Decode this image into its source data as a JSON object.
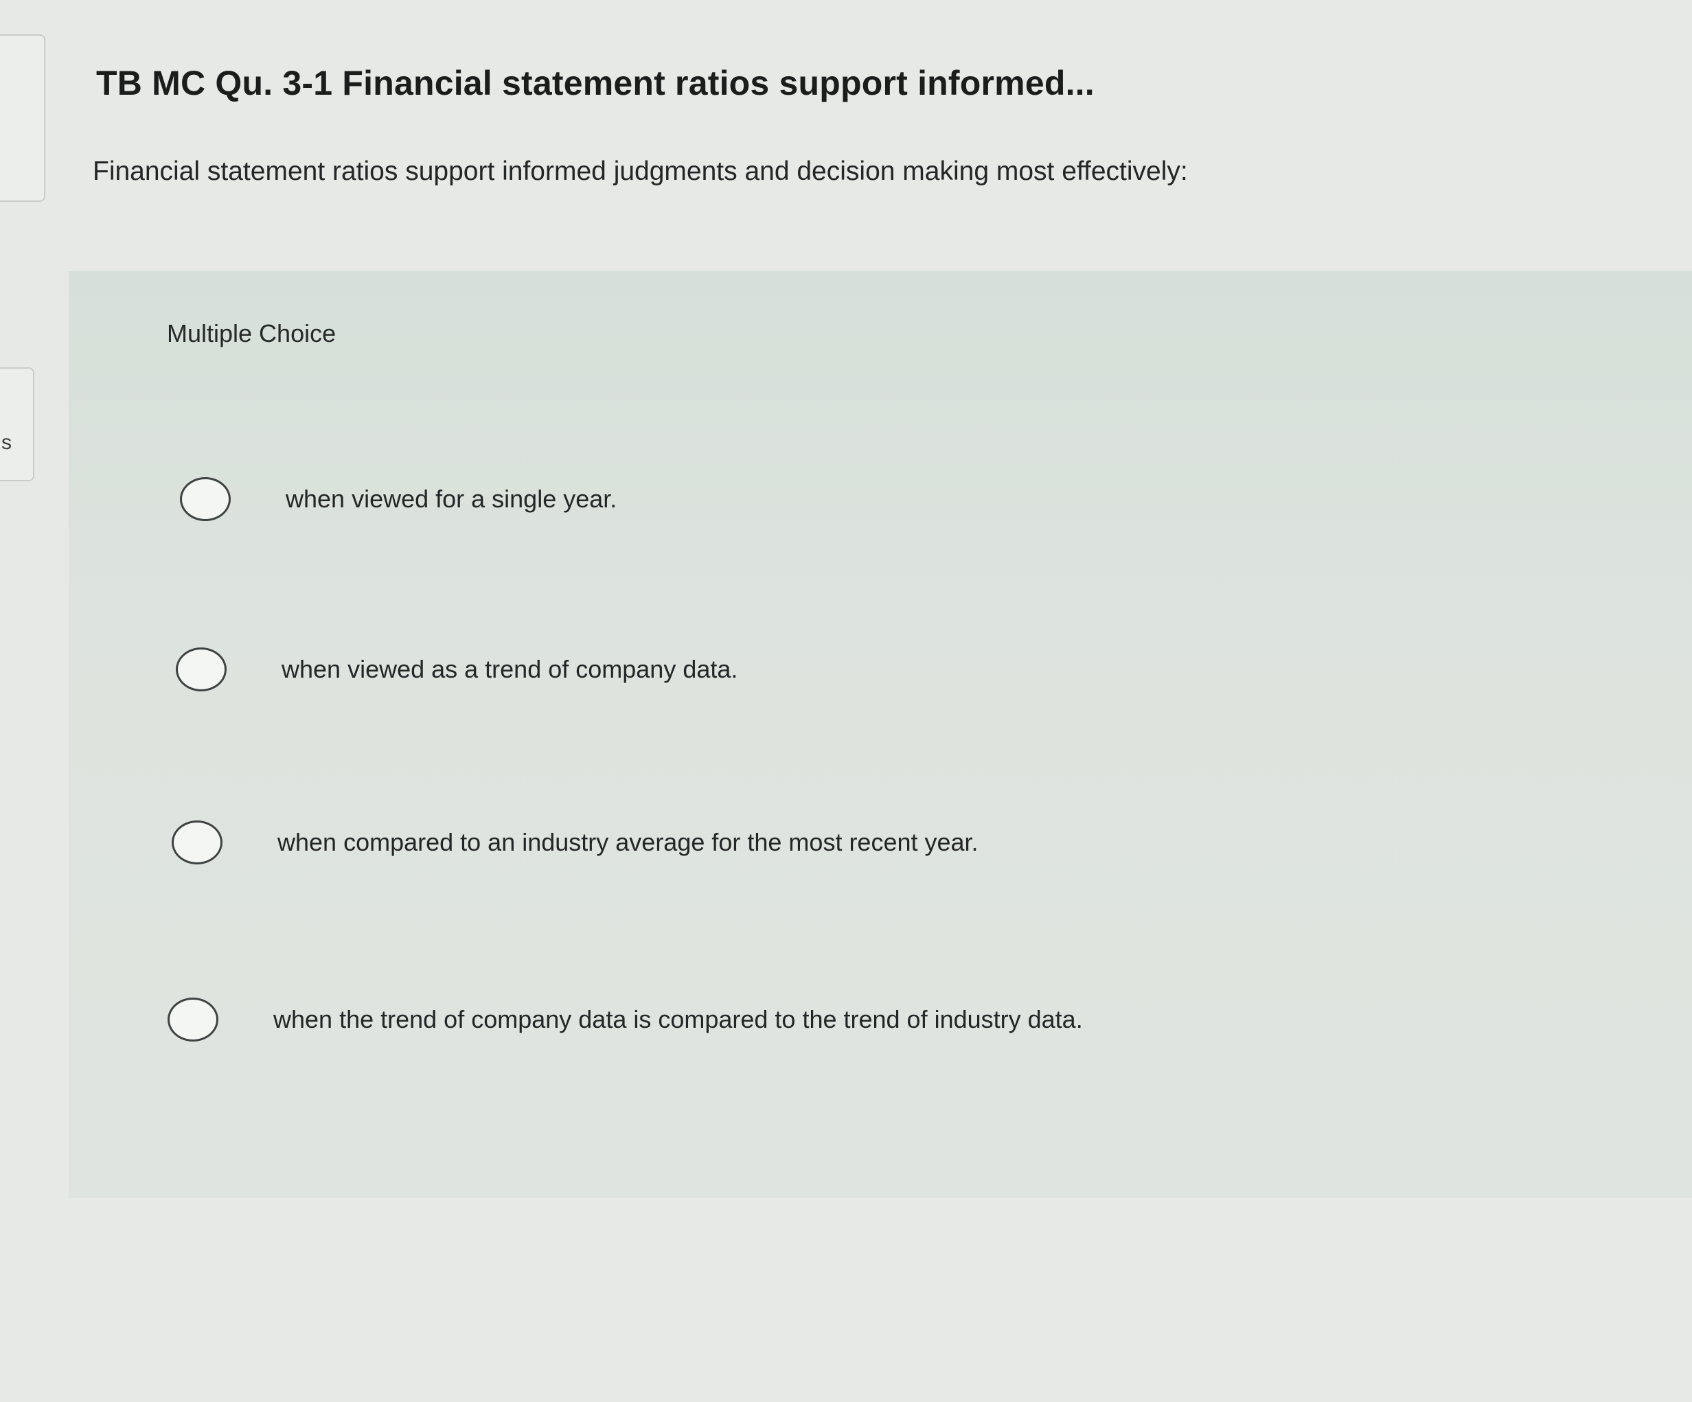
{
  "sidebar": {
    "tab_letter": "s"
  },
  "question": {
    "title": "TB MC Qu. 3-1 Financial statement ratios support informed...",
    "text": "Financial statement ratios support informed judgments and decision making most effectively:"
  },
  "choice_panel": {
    "type_label": "Multiple Choice",
    "options": [
      {
        "label": "when viewed for a single year.",
        "selected": false
      },
      {
        "label": "when viewed as a trend of company data.",
        "selected": false
      },
      {
        "label": "when compared to an industry average for the most recent year.",
        "selected": false
      },
      {
        "label": "when the trend of company data is compared to the trend of industry data.",
        "selected": false
      }
    ]
  }
}
